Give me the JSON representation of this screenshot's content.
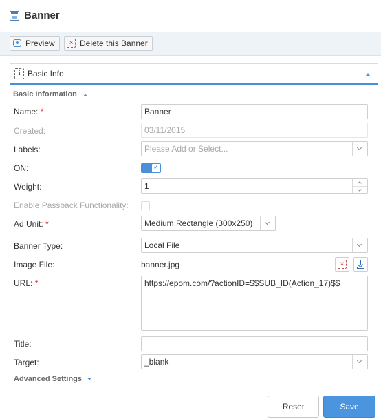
{
  "window": {
    "title": "Banner",
    "icon": "banner-icon"
  },
  "toolbar": {
    "preview_label": "Preview",
    "delete_label": "Delete this Banner"
  },
  "panel": {
    "title": "Basic Info"
  },
  "sections": {
    "basic": "Basic Information",
    "advanced": "Advanced Settings"
  },
  "form": {
    "name": {
      "label": "Name:",
      "required": "*",
      "value": "Banner"
    },
    "created": {
      "label": "Created:",
      "value": "03/11/2015"
    },
    "labels": {
      "label": "Labels:",
      "placeholder": "Please Add or Select..."
    },
    "on": {
      "label": "ON:",
      "checked": true
    },
    "weight": {
      "label": "Weight:",
      "value": "1"
    },
    "passback": {
      "label": "Enable Passback Functionality:",
      "checked": false
    },
    "ad_unit": {
      "label": "Ad Unit:",
      "required": "*",
      "value": "Medium Rectangle (300x250)"
    },
    "banner_type": {
      "label": "Banner Type:",
      "value": "Local File"
    },
    "image_file": {
      "label": "Image File:",
      "value": "banner.jpg"
    },
    "url": {
      "label": "URL:",
      "required": "*",
      "value": "https://epom.com/?actionID=$$SUB_ID(Action_17)$$"
    },
    "title": {
      "label": "Title:",
      "value": ""
    },
    "target": {
      "label": "Target:",
      "value": "_blank"
    }
  },
  "buttons": {
    "reset": "Reset",
    "save": "Save"
  },
  "colors": {
    "accent": "#4a90d9",
    "required": "#d22222",
    "save_bg": "#4a95de"
  }
}
